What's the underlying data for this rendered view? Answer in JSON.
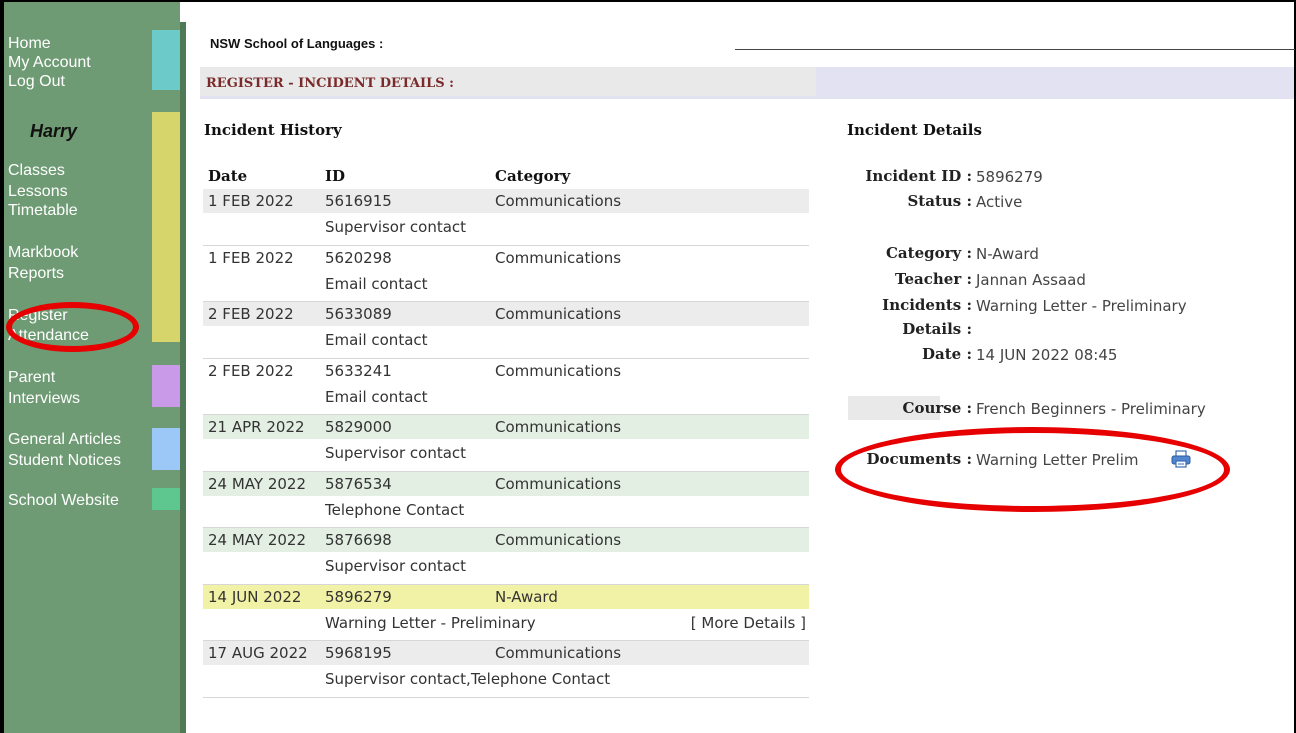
{
  "sidebar": {
    "top_links": [
      "Home",
      "My Account",
      "Log Out"
    ],
    "user_name": "Harry",
    "groups": [
      {
        "items": [
          "Classes",
          "Lessons",
          "Timetable"
        ]
      },
      {
        "items": [
          "Markbook",
          "Reports"
        ]
      },
      {
        "items": [
          "Register",
          "Attendance"
        ]
      },
      {
        "items": [
          "Parent",
          "Interviews"
        ]
      },
      {
        "items": [
          "General Articles",
          "Student Notices"
        ]
      },
      {
        "items": [
          "School Website"
        ]
      }
    ],
    "bar_colors": {
      "account": "#6ccac8",
      "classes": "#d6d56b",
      "interviews": "#c99ae8",
      "articles": "#9cc8f8",
      "website": "#5ec78f"
    }
  },
  "header": {
    "school": "NSW School of Languages :",
    "register_title": "REGISTER - INCIDENT DETAILS :"
  },
  "history": {
    "heading": "Incident History",
    "columns": [
      "Date",
      "ID",
      "Category"
    ],
    "rows": [
      {
        "date": "1 FEB 2022",
        "id": "5616915",
        "category": "Communications",
        "description": "Supervisor contact",
        "shade": "gray",
        "more": ""
      },
      {
        "date": "1 FEB 2022",
        "id": "5620298",
        "category": "Communications",
        "description": "Email contact",
        "shade": "none",
        "more": ""
      },
      {
        "date": "2 FEB 2022",
        "id": "5633089",
        "category": "Communications",
        "description": "Email contact",
        "shade": "gray",
        "more": ""
      },
      {
        "date": "2 FEB 2022",
        "id": "5633241",
        "category": "Communications",
        "description": "Email contact",
        "shade": "none",
        "more": ""
      },
      {
        "date": "21 APR 2022",
        "id": "5829000",
        "category": "Communications",
        "description": "Supervisor contact",
        "shade": "green",
        "more": ""
      },
      {
        "date": "24 MAY 2022",
        "id": "5876534",
        "category": "Communications",
        "description": "Telephone Contact",
        "shade": "green",
        "more": ""
      },
      {
        "date": "24 MAY 2022",
        "id": "5876698",
        "category": "Communications",
        "description": "Supervisor contact",
        "shade": "green",
        "more": ""
      },
      {
        "date": "14 JUN 2022",
        "id": "5896279",
        "category": "N-Award",
        "description": "Warning Letter - Preliminary",
        "shade": "yellow",
        "more": "[ More Details ]"
      },
      {
        "date": "17 AUG 2022",
        "id": "5968195",
        "category": "Communications",
        "description": "Supervisor contact,Telephone Contact",
        "shade": "gray",
        "more": ""
      }
    ],
    "shade_colors": {
      "gray": "#ececec",
      "green": "#e3efe3",
      "yellow": "#f2f2a6",
      "none": "#ffffff"
    }
  },
  "details": {
    "heading": "Incident Details",
    "incident_id_label": "Incident ID :",
    "incident_id": "5896279",
    "status_label": "Status :",
    "status": "Active",
    "category_label": "Category :",
    "category": "N-Award",
    "teacher_label": "Teacher :",
    "teacher": "Jannan Assaad",
    "incidents_label": "Incidents :",
    "incidents": "Warning Letter - Preliminary",
    "details_label": "Details :",
    "date_label": "Date :",
    "date": "14 JUN 2022 08:45",
    "course_label": "Course :",
    "course": "French Beginners - Preliminary",
    "documents_label": "Documents :",
    "document": "Warning Letter Prelim"
  }
}
